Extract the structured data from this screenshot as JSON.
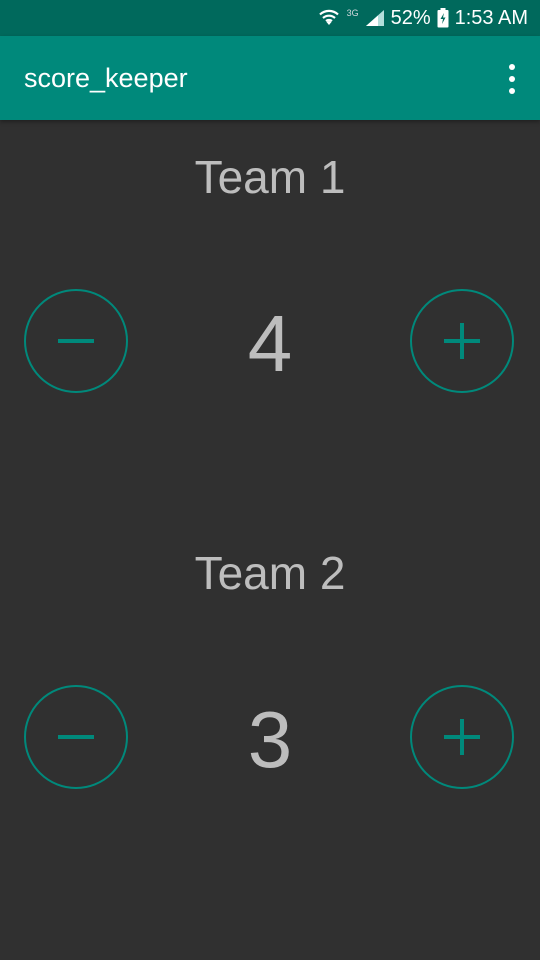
{
  "status_bar": {
    "network_label": "3G",
    "battery": "52%",
    "time": "1:53 AM",
    "icons": [
      "wifi-icon",
      "signal-icon",
      "battery-charging-icon"
    ]
  },
  "app_bar": {
    "title": "score_keeper",
    "overflow_icon": "more-vert-icon"
  },
  "teams": [
    {
      "label": "Team 1",
      "score": "4"
    },
    {
      "label": "Team 2",
      "score": "3"
    }
  ],
  "colors": {
    "status_bar": "#00695C",
    "app_bar": "#00897B",
    "accent": "#00897B",
    "background": "#303030",
    "text": "#BDBDBD"
  }
}
